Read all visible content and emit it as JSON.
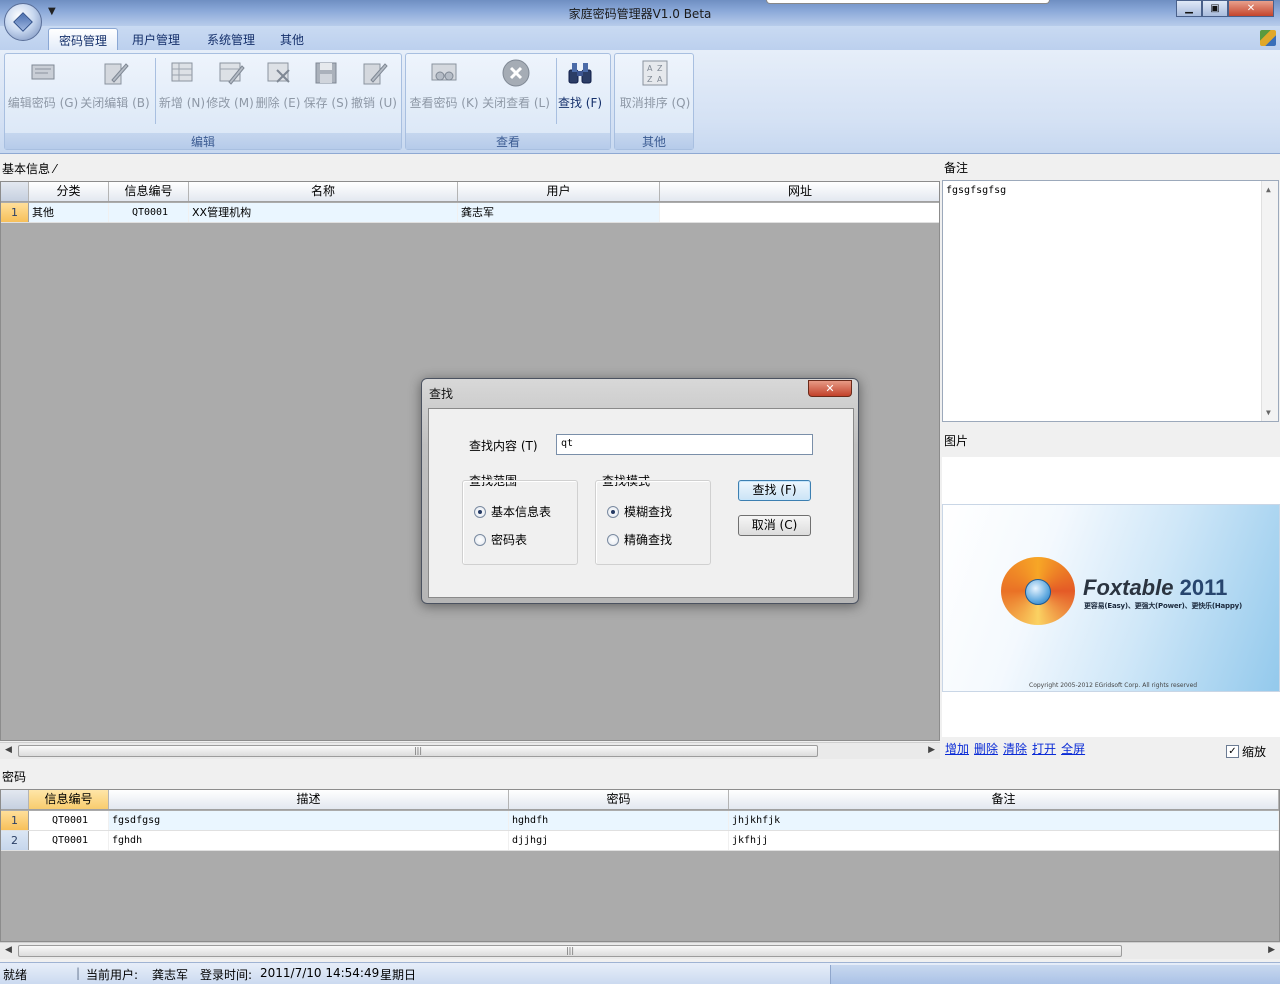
{
  "window": {
    "title": "家庭密码管理器V1.0 Beta",
    "minimize": "▁",
    "maximize": "▣",
    "close": "✕"
  },
  "ribbon": {
    "tabs": [
      "密码管理",
      "用户管理",
      "系统管理",
      "其他"
    ],
    "groups": {
      "edit": {
        "label": "编辑",
        "buttons": [
          "编辑密码 (G)",
          "关闭编辑 (B)",
          "新增 (N)",
          "修改 (M)",
          "删除 (E)",
          "保存 (S)",
          "撤销 (U)"
        ]
      },
      "view": {
        "label": "查看",
        "buttons": [
          "查看密码 (K)",
          "关闭查看 (L)",
          "查找 (F)"
        ]
      },
      "other": {
        "label": "其他",
        "buttons": [
          "取消排序 (Q)"
        ]
      }
    }
  },
  "basic_info": {
    "caption": "基本信息 ⁄",
    "columns": [
      "分类",
      "信息编号",
      "名称",
      "用户",
      "网址"
    ],
    "rows": [
      {
        "num": "1",
        "category": "其他",
        "id": "QT0001",
        "name": "XX管理机构",
        "user": "龚志军",
        "url": ""
      }
    ]
  },
  "notes": {
    "caption": "备注",
    "text": "fgsgfsgfsg"
  },
  "picture": {
    "caption": "图片",
    "logo_title": "Foxtable",
    "logo_year": "2011",
    "logo_slogan": "更容易(Easy)、更强大(Power)、更快乐(Happy)",
    "logo_copyright": "Copyright 2005-2012 EGridsoft Corp. All rights reserved",
    "links": [
      "增加",
      "删除",
      "清除",
      "打开",
      "全屏"
    ],
    "zoom_label": "缩放",
    "zoom_checked": true
  },
  "passwords": {
    "caption": "密码",
    "columns": [
      "信息编号",
      "描述",
      "密码",
      "备注"
    ],
    "rows": [
      {
        "num": "1",
        "id": "QT0001",
        "desc": "fgsdfgsg",
        "pwd": "hghdfh",
        "note": "jhjkhfjk"
      },
      {
        "num": "2",
        "id": "QT0001",
        "desc": "fghdh",
        "pwd": "djjhgj",
        "note": "jkfhjj"
      }
    ]
  },
  "status": {
    "ready": "就绪",
    "user_label": "当前用户:",
    "user": "龚志军",
    "login_label": "登录时间:",
    "login_time": "2011/7/10 14:54:49",
    "weekday": "星期日"
  },
  "dialog": {
    "title": "查找",
    "content_label": "查找内容 (T)",
    "content_value": "qt",
    "scope_label": "查找范围",
    "scope_options": [
      "基本信息表",
      "密码表"
    ],
    "scope_selected": 0,
    "mode_label": "查找模式",
    "mode_options": [
      "模糊查找",
      "精确查找"
    ],
    "mode_selected": 0,
    "find_button": "查找 (F)",
    "cancel_button": "取消 (C)"
  }
}
